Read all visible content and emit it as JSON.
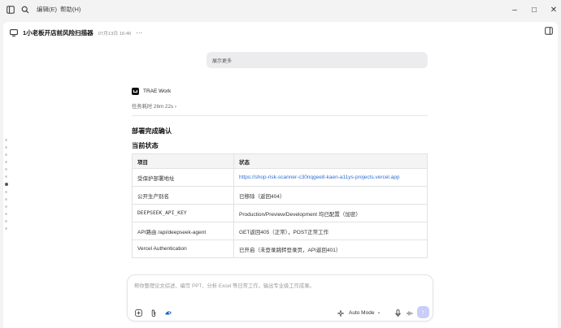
{
  "menubar": {
    "edit": "编辑(E)",
    "help": "帮助(H)"
  },
  "window_controls": {
    "minimize": "–",
    "maximize": "□",
    "close": "✕"
  },
  "chat": {
    "title": "1小老板开店前风险扫描器",
    "timestamp": "07月13日 16:40",
    "more": "···"
  },
  "thread": {
    "show_more": "展示更多",
    "agent_name": "TRAE Work",
    "elapsed": "任务耗时 26m 22s",
    "elapsed_chevron": "›",
    "heading_deploy": "部署完成确认",
    "heading_status": "当前状态"
  },
  "table": {
    "headers": [
      "项目",
      "状态"
    ],
    "rows": [
      [
        "受保护部署地址",
        "https://shop-risk-scanner-c30nqgee8-kaen-a11ys-projects.vercel.app"
      ],
      [
        "公开生产别名",
        "已移除（返回404）"
      ],
      [
        "DEEPSEEK_API_KEY",
        "Production/Preview/Development 均已配置（加密）"
      ],
      [
        "API路由 /api/deepseek-agent",
        "GET返回405（正常），POST正常工作"
      ],
      [
        "Vercel Authentication",
        "已开启（未登录跳转登录页，API返回401）"
      ]
    ]
  },
  "composer": {
    "placeholder": "帮你整理论文综述、编写 PPT、分析 Excel 等日常工作，输出专业级工作成果。",
    "mode_label": "Auto Mode",
    "mode_chevron": "⌄",
    "send": "↑"
  },
  "colors": {
    "link": "#2f6fd8",
    "send_button": "#c9cdf7",
    "table_header_bg": "#f4f4f5"
  }
}
